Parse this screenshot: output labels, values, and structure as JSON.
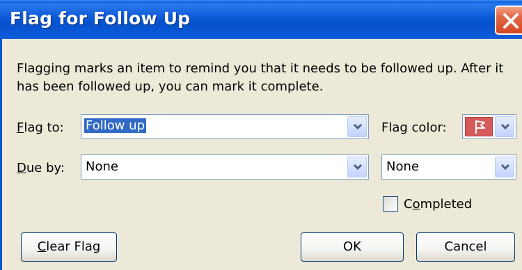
{
  "window": {
    "title": "Flag for Follow Up"
  },
  "description": "Flagging marks an item to remind you that it needs to be followed up.  After it has been followed up, you can mark it complete.",
  "flag_to": {
    "label_hot": "F",
    "label_rest": "lag to:",
    "value": "Follow up"
  },
  "flag_color": {
    "label": "Flag color:",
    "selected_color": "#d55b5b"
  },
  "due_by": {
    "label_hot": "D",
    "label_rest": "ue by:",
    "date_value": "None",
    "time_value": "None"
  },
  "completed": {
    "label_pre": "C",
    "label_hot": "o",
    "label_rest": "mpleted",
    "checked": false
  },
  "buttons": {
    "clear_hot": "C",
    "clear_rest": "lear Flag",
    "ok": "OK",
    "cancel": "Cancel"
  },
  "colors": {
    "title_bar": "#0a58d6",
    "dialog_bg": "#ECE9D8",
    "selection": "#316ac5"
  }
}
